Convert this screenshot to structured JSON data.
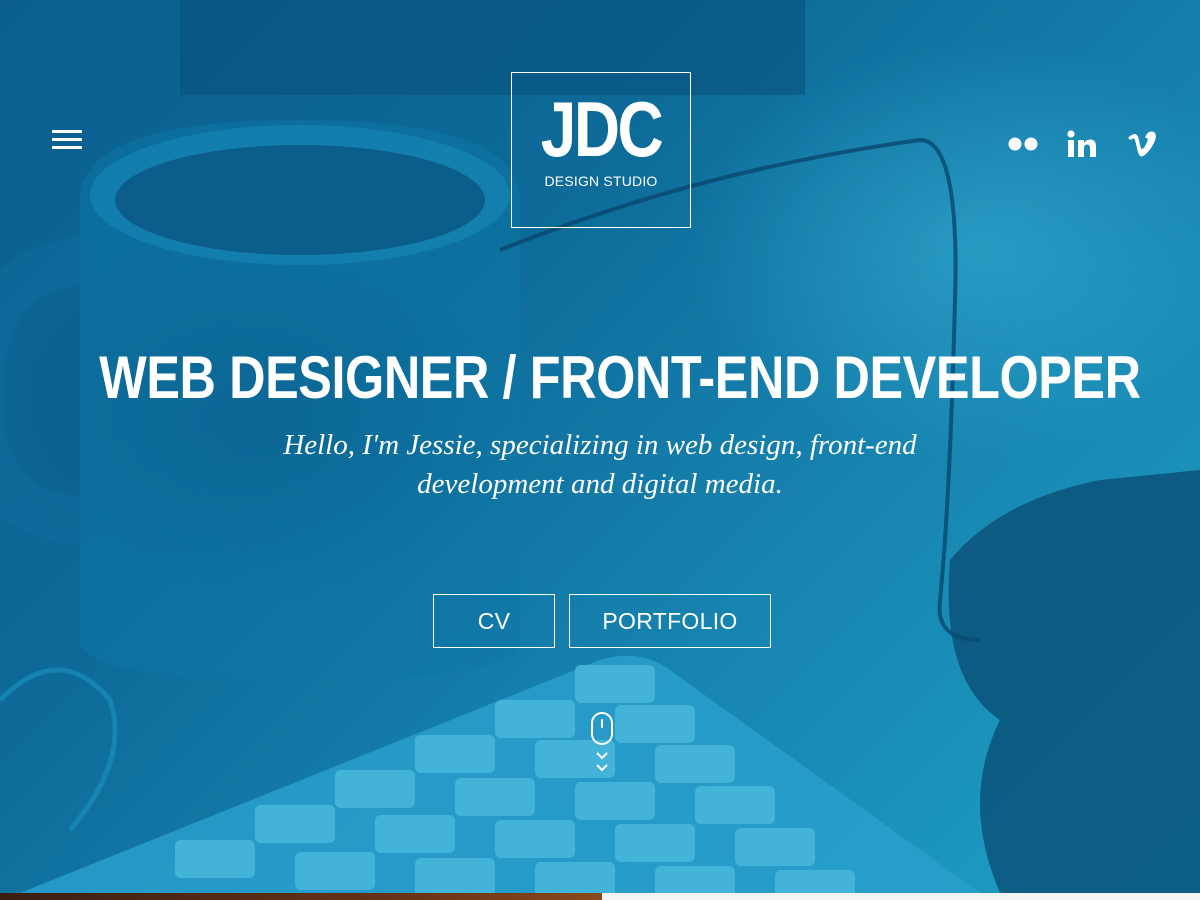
{
  "header": {
    "menu_icon": "hamburger-menu-icon",
    "logo": {
      "mark": "JDC",
      "subtitle": "DESIGN STUDIO"
    },
    "social": [
      {
        "name": "flickr",
        "icon": "flickr-icon"
      },
      {
        "name": "linkedin",
        "icon": "linkedin-icon",
        "glyph": "in"
      },
      {
        "name": "vimeo",
        "icon": "vimeo-icon",
        "glyph": "v"
      }
    ]
  },
  "hero": {
    "headline": "WEB DESIGNER / FRONT-END DEVELOPER",
    "tagline": "Hello, I'm Jessie, specializing in web design, front-end development and digital media.",
    "buttons": {
      "cv_label": "CV",
      "portfolio_label": "PORTFOLIO"
    },
    "scroll_icon": "mouse-scroll-icon"
  },
  "colors": {
    "overlay_dark": "#0a5f8f",
    "overlay_light": "#1ea1c6",
    "text": "#ffffff"
  }
}
